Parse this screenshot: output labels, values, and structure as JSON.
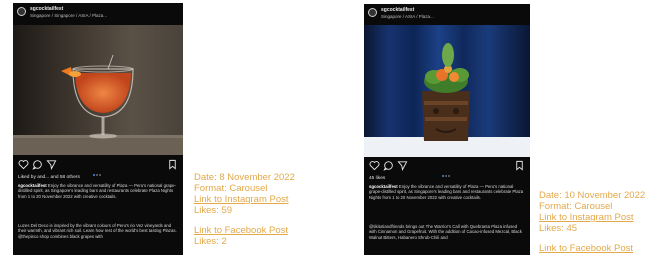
{
  "posts": [
    {
      "username": "sgcocktailfest",
      "location": "Singapore / Singapore / ASIA / Plaza...",
      "likes_line": "Liked by and... and 58 others",
      "caption_user": "sgcocktailfest",
      "caption": "Enjoy the vibrance and versatility of Plaza — Peru's national grape-distilled spirit, as Singapore's leading bars and restaurants celebrate Plaza Nights from 1 to 20 November 2022 with creative cocktails.",
      "caption_more": "Luzes Del Deco is inspired by the vibrant colours of Peru's rio Vez vineyards and their warmth, and vibrant rich soil. Learn how rest of the world's best tasting Plazas. @thepisco shop combines black grapes with",
      "meta": {
        "date": "Date: 8 November 2022",
        "format": "Format: Carousel",
        "instagram_link": "Link to Instagram Post",
        "instagram_likes": "Likes: 59",
        "facebook_link": "Link to Facebook Post",
        "facebook_likes": "Likes: 2"
      }
    },
    {
      "username": "sgcocktailfest",
      "location": "Singapore / ASIA / Plaza...",
      "likes_line": "45 likes",
      "caption_user": "sgcocktailfest",
      "caption": "Enjoy the vibrance and versatility of Plaza — Peru's national grape-distilled spirit, as Singapore's leading bars and restaurants celebrate Plaza Nights from 1 to 20 November 2022 with creative cocktails.",
      "caption_more": "@tikitotiandfriends brings out The Warrior's Call with Quebranta Plaza infused with Cinnamon and Grapefruit. With the addition of Cacao-infused Mezcal, Black Walnut Bitters, Habanero Shrub-Chili and",
      "meta": {
        "date": "Date: 10 November 2022",
        "format": "Format: Carousel",
        "instagram_link": "Link to Instagram Post",
        "instagram_likes": "Likes: 45",
        "facebook_link": "Link to Facebook Post"
      }
    }
  ],
  "colors": {
    "meta_text": "#e3a94a",
    "phone_bg": "#0a0a0a"
  },
  "icons": [
    "heart-icon",
    "comment-icon",
    "share-icon",
    "bookmark-icon",
    "carousel-dots"
  ]
}
